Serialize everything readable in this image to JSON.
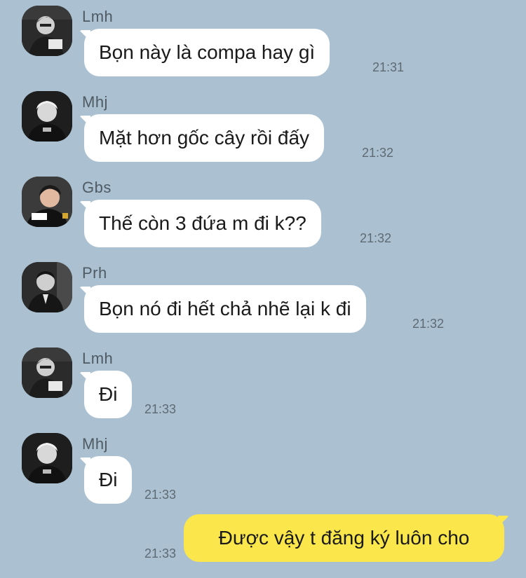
{
  "theme": {
    "background": "#abc1d1",
    "incoming_bubble": "#ffffff",
    "outgoing_bubble": "#fbe74b"
  },
  "messages": [
    {
      "sender": "Lmh",
      "text": "Bọn này là compa hay gì",
      "time": "21:31",
      "avatar_icon": "user-avatar-icon"
    },
    {
      "sender": "Mhj",
      "text": "Mặt hơn gốc cây rồi đấy",
      "time": "21:32",
      "avatar_icon": "user-avatar-icon"
    },
    {
      "sender": "Gbs",
      "text": "Thế còn 3 đứa m đi k??",
      "time": "21:32",
      "avatar_icon": "user-avatar-icon"
    },
    {
      "sender": "Prh",
      "text": "Bọn nó đi hết chả nhẽ lại k đi",
      "time": "21:32",
      "avatar_icon": "user-avatar-icon"
    },
    {
      "sender": "Lmh",
      "text": "Đi",
      "time": "21:33",
      "avatar_icon": "user-avatar-icon"
    },
    {
      "sender": "Mhj",
      "text": "Đi",
      "time": "21:33",
      "avatar_icon": "user-avatar-icon"
    }
  ],
  "my_message": {
    "text": "Được vậy t đăng ký luôn cho",
    "time": "21:33"
  }
}
